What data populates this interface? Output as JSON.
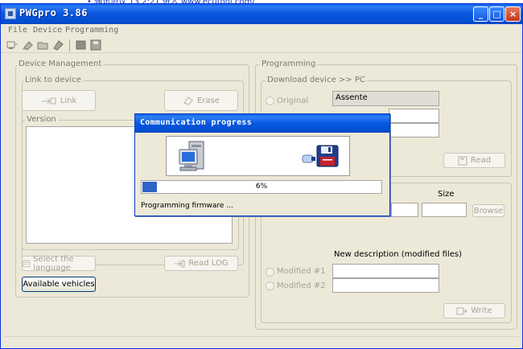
{
  "window": {
    "title": "PWGpro 3.86",
    "controls": {
      "minimize": "_",
      "maximize": "□",
      "close": "×"
    }
  },
  "menu": [
    "File",
    "Device",
    "Programming"
  ],
  "device_management": {
    "legend": "Device Management",
    "link_group_legend": "Link to device",
    "link_button": "Link",
    "erase_button": "Erase",
    "version_legend": "Version",
    "select_language_button": "Select the language",
    "read_log_button": "Read LOG",
    "available_vehicles_button": "Available vehicles"
  },
  "programming": {
    "legend": "Programming",
    "download_legend": "Download device >> PC",
    "original_radio": "Original",
    "original_value": "Assente",
    "read_button": "Read",
    "size_label": "Size",
    "browse_button": "Browse",
    "new_description_label": "New description (modified files)",
    "modified1_radio": "Modified #1",
    "modified2_radio": "Modified #2",
    "write_button": "Write"
  },
  "progress_dialog": {
    "title": "Communication progress",
    "percent_text": "6%",
    "percent_value": 6,
    "status": "Programming firmware ...",
    "fill_color": "#2f63c9"
  }
}
